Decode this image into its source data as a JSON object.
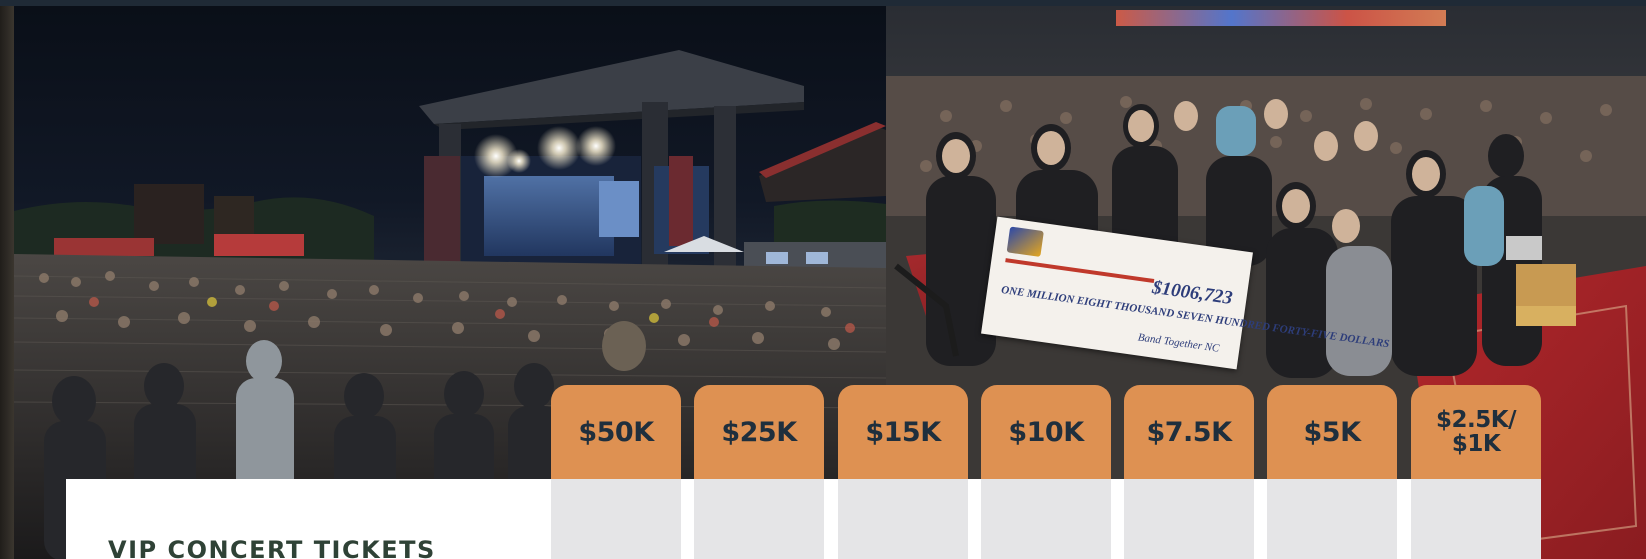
{
  "check": {
    "amount": "$1006,723",
    "amount_words": "ONE MILLION EIGHT THOUSAND SEVEN HUNDRED FORTY-FIVE DOLLARS",
    "signature": "Band Together NC"
  },
  "section": {
    "title": "VIP CONCERT TICKETS"
  },
  "tiers": [
    {
      "label": "$50K"
    },
    {
      "label": "$25K"
    },
    {
      "label": "$15K"
    },
    {
      "label": "$10K"
    },
    {
      "label": "$7.5K"
    },
    {
      "label": "$5K"
    },
    {
      "label": "$2.5K/ $1K"
    }
  ],
  "colors": {
    "tier_header": "#de9152",
    "tier_body": "#e5e5e7",
    "tier_text": "#1f2f3d",
    "title_text": "#2f4236"
  }
}
